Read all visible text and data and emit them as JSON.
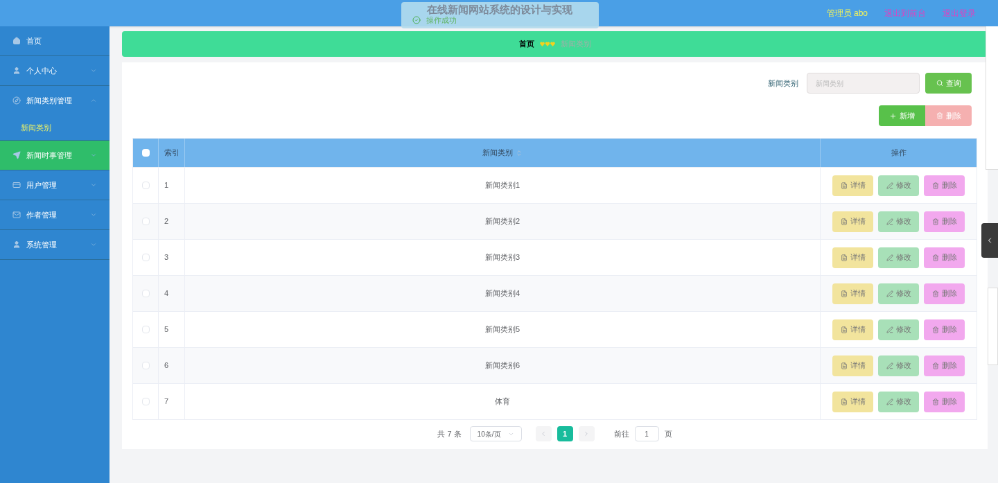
{
  "header": {
    "title": "在线新闻网站系统的设计与实现",
    "user": "管理员 abo",
    "links": [
      "退出到前台",
      "退出登录"
    ]
  },
  "toast": {
    "message": "操作成功"
  },
  "sidebar": {
    "items": [
      {
        "label": "首页",
        "expandable": false,
        "hovered": false
      },
      {
        "label": "个人中心",
        "expandable": true,
        "expanded": false,
        "hovered": false
      },
      {
        "label": "新闻类别管理",
        "expandable": true,
        "expanded": true,
        "hovered": false,
        "children": [
          {
            "label": "新闻类别",
            "selected": true
          }
        ]
      },
      {
        "label": "新闻时事管理",
        "expandable": true,
        "expanded": false,
        "hovered": true
      },
      {
        "label": "用户管理",
        "expandable": true,
        "expanded": false,
        "hovered": false
      },
      {
        "label": "作者管理",
        "expandable": true,
        "expanded": false,
        "hovered": false
      },
      {
        "label": "系统管理",
        "expandable": true,
        "expanded": false,
        "hovered": false
      }
    ]
  },
  "breadcrumb": {
    "home": "首页",
    "current": "新闻类别"
  },
  "search": {
    "label": "新闻类别",
    "placeholder": "新闻类别",
    "button": "查询"
  },
  "actions": {
    "add": "新增",
    "delete": "删除",
    "delete_disabled": true
  },
  "table": {
    "columns": [
      "索引",
      "新闻类别",
      "操作"
    ],
    "select_all_checked": false,
    "rows": [
      {
        "index": "1",
        "category": "新闻类别1",
        "checked": false,
        "buttons": [
          "详情",
          "修改",
          "删除"
        ]
      },
      {
        "index": "2",
        "category": "新闻类别2",
        "checked": false,
        "buttons": [
          "详情",
          "修改",
          "删除"
        ]
      },
      {
        "index": "3",
        "category": "新闻类别3",
        "checked": false,
        "buttons": [
          "详情",
          "修改",
          "删除"
        ]
      },
      {
        "index": "4",
        "category": "新闻类别4",
        "checked": false,
        "buttons": [
          "详情",
          "修改",
          "删除"
        ]
      },
      {
        "index": "5",
        "category": "新闻类别5",
        "checked": false,
        "buttons": [
          "详情",
          "修改",
          "删除"
        ]
      },
      {
        "index": "6",
        "category": "新闻类别6",
        "checked": false,
        "buttons": [
          "详情",
          "修改",
          "删除"
        ]
      },
      {
        "index": "7",
        "category": "体育",
        "checked": false,
        "buttons": [
          "详情",
          "修改",
          "删除"
        ]
      }
    ]
  },
  "pagination": {
    "total": "共 7 条",
    "page_size": "10条/页",
    "pages": [
      {
        "label": "1",
        "selected": true
      }
    ],
    "goto_label": "前往",
    "goto_value": "1",
    "goto_suffix": "页"
  }
}
